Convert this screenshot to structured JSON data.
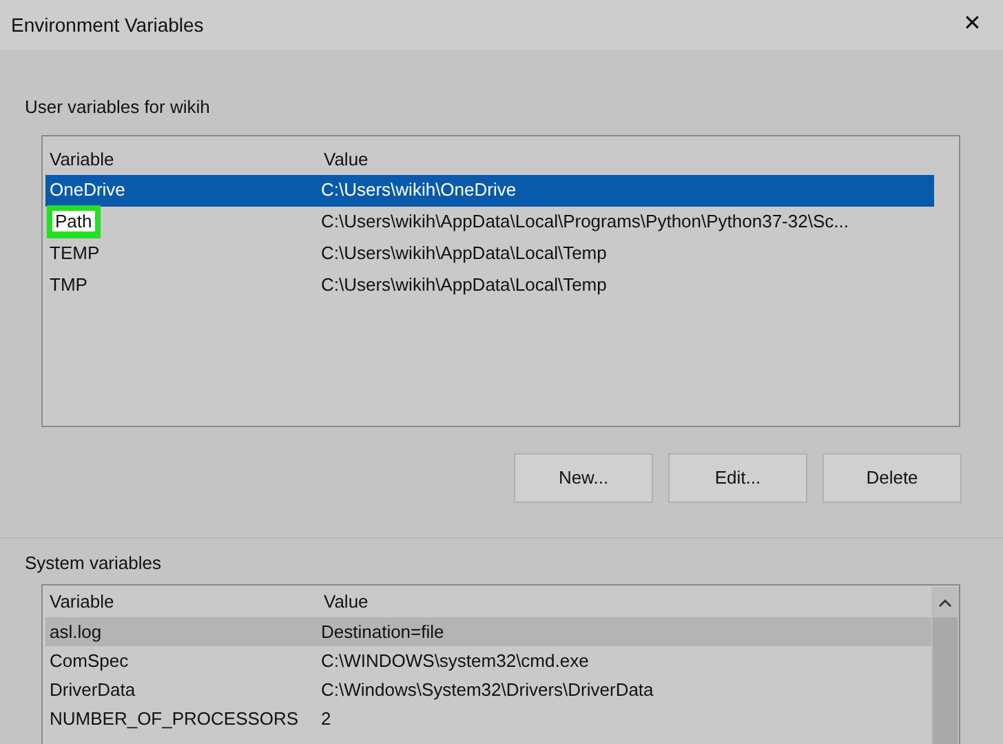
{
  "window": {
    "title": "Environment Variables",
    "close": "✕"
  },
  "user_variables": {
    "label": "User variables for wikih",
    "columns": [
      "Variable",
      "Value"
    ],
    "rows": [
      {
        "variable": "OneDrive",
        "value": "C:\\Users\\wikih\\OneDrive",
        "selected": true,
        "highlighted": false
      },
      {
        "variable": "Path",
        "value": "C:\\Users\\wikih\\AppData\\Local\\Programs\\Python\\Python37-32\\Sc...",
        "selected": false,
        "highlighted": true
      },
      {
        "variable": "TEMP",
        "value": "C:\\Users\\wikih\\AppData\\Local\\Temp",
        "selected": false,
        "highlighted": false
      },
      {
        "variable": "TMP",
        "value": "C:\\Users\\wikih\\AppData\\Local\\Temp",
        "selected": false,
        "highlighted": false
      }
    ],
    "buttons": [
      "New...",
      "Edit...",
      "Delete"
    ]
  },
  "system_variables": {
    "label": "System variables",
    "columns": [
      "Variable",
      "Value"
    ],
    "rows": [
      {
        "variable": "asl.log",
        "value": "Destination=file",
        "selected": true
      },
      {
        "variable": "ComSpec",
        "value": "C:\\WINDOWS\\system32\\cmd.exe",
        "selected": false
      },
      {
        "variable": "DriverData",
        "value": "C:\\Windows\\System32\\Drivers\\DriverData",
        "selected": false
      },
      {
        "variable": "NUMBER_OF_PROCESSORS",
        "value": "2",
        "selected": false
      }
    ]
  }
}
